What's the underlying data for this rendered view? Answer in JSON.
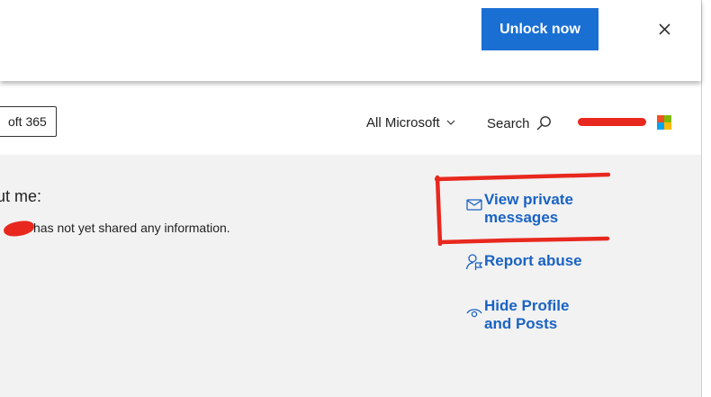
{
  "banner": {
    "unlock_label": "Unlock now",
    "close_icon": "close-icon"
  },
  "header": {
    "product_label": "oft 365",
    "all_microsoft": "All Microsoft",
    "search_label": "Search",
    "logo_colors": [
      "#f25022",
      "#7fba00",
      "#00a4ef",
      "#ffb900"
    ],
    "redaction_color": "#e8281f"
  },
  "profile": {
    "about_title": "ut me:",
    "about_text": "has not yet shared any information."
  },
  "actions": {
    "view_private_messages": {
      "line1": "View private",
      "line2": "messages",
      "icon": "envelope-icon"
    },
    "report_abuse": {
      "label": "Report abuse",
      "icon": "report-user-icon"
    },
    "hide_profile": {
      "line1": "Hide Profile",
      "line2": "and Posts",
      "icon": "eye-icon"
    }
  },
  "colors": {
    "accent_button": "#1a6fd3",
    "link": "#1a63c4",
    "annotation": "#e8281f",
    "page_background": "#f2f2f2"
  }
}
